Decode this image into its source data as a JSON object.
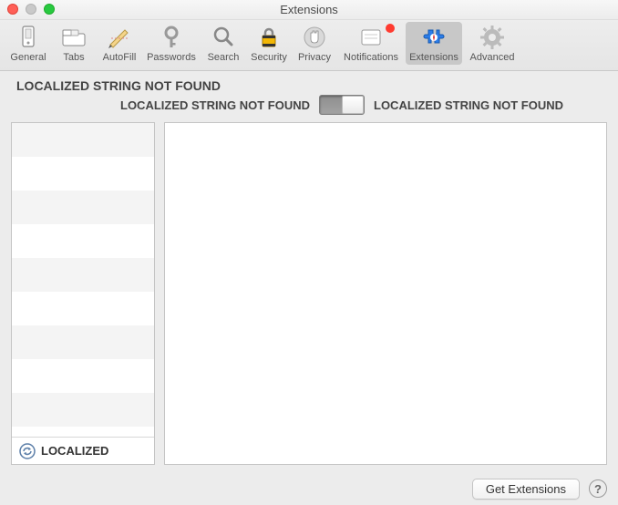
{
  "window": {
    "title": "Extensions"
  },
  "toolbar": {
    "items": [
      {
        "label": "General"
      },
      {
        "label": "Tabs"
      },
      {
        "label": "AutoFill"
      },
      {
        "label": "Passwords"
      },
      {
        "label": "Search"
      },
      {
        "label": "Security"
      },
      {
        "label": "Privacy"
      },
      {
        "label": "Notifications",
        "has_badge": true
      },
      {
        "label": "Extensions",
        "selected": true
      },
      {
        "label": "Advanced"
      }
    ]
  },
  "header": {
    "error_text": "LOCALIZED STRING NOT FOUND",
    "toggle_left_label": "LOCALIZED STRING NOT FOUND",
    "toggle_right_label": "LOCALIZED STRING NOT FOUND",
    "toggle_state": "off"
  },
  "sidebar": {
    "footer_label": "LOCALIZED"
  },
  "footer": {
    "get_extensions_label": "Get Extensions",
    "help_label": "?"
  }
}
